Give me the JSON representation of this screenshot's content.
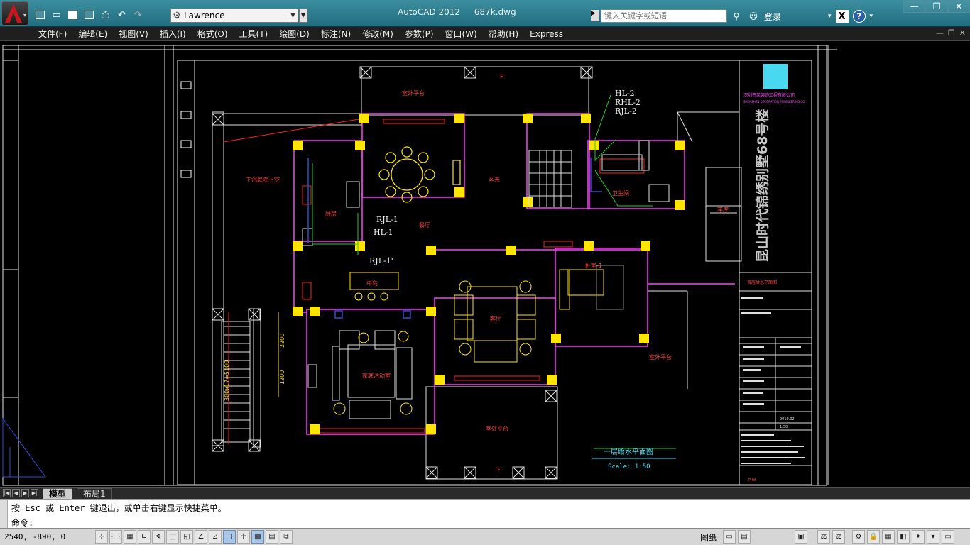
{
  "window": {
    "app_name": "AutoCAD 2012",
    "file_name": "687k.dwg",
    "minimize": "—",
    "restore": "❐",
    "close": "✕"
  },
  "quick_access": {
    "workspace": "Lawrence",
    "icons": [
      "new-icon",
      "open-icon",
      "save-icon",
      "saveas-icon",
      "print-icon",
      "undo-icon",
      "redo-icon"
    ]
  },
  "search": {
    "placeholder": "键入关键字或短语"
  },
  "user": {
    "login_label": "登录"
  },
  "menu": {
    "items": [
      "文件(F)",
      "编辑(E)",
      "视图(V)",
      "插入(I)",
      "格式(O)",
      "工具(T)",
      "绘图(D)",
      "标注(N)",
      "修改(M)",
      "参数(P)",
      "窗口(W)",
      "帮助(H)",
      "Express"
    ]
  },
  "drawing": {
    "rooms": {
      "outdoor_top": "室外平台",
      "outdoor_right": "室外平台",
      "outdoor_bottom": "室外平台",
      "foyer": "玄关",
      "dining": "餐厅",
      "kitchen": "厨房",
      "island": "中岛",
      "living": "客厅",
      "family": "家庭活动室",
      "bath": "卫生间",
      "bedroom": "卧室-1",
      "garage": "车库",
      "stair_up": "下沉庭院上空"
    },
    "pipes": {
      "hl2": "HL-2",
      "rhl2": "RHL-2",
      "rjl2": "RJL-2",
      "rjl1": "RJL-1",
      "hl1": "HL-1",
      "rjl1p": "RJL-1'"
    },
    "down_top": "下",
    "down_bottom": "下",
    "dim_2200": "2200",
    "dim_1200": "1200",
    "dim_stair": "300x17=5100",
    "plan_title": "一层给水平面图",
    "scale": "Scale: 1:50",
    "title_block": {
      "company_cn": "深圳市某装饰工程有限公司",
      "company_en": "SHENZHEN DECORATION ENGINEERING CO.",
      "project": "昆山时代锦绣别墅68号楼",
      "drawing_name": "首层给水平面图",
      "scale_val": "1:50",
      "sheet_no": "P-06",
      "date": "2010.02"
    }
  },
  "layout_tabs": {
    "model": "模型",
    "layout1": "布局1"
  },
  "command": {
    "prompt1": "按 Esc 或 Enter 键退出，或单击右键显示快捷菜单。",
    "prompt2": "命令:"
  },
  "status": {
    "coords": "2540, -890, 0",
    "model_label": "图纸"
  }
}
